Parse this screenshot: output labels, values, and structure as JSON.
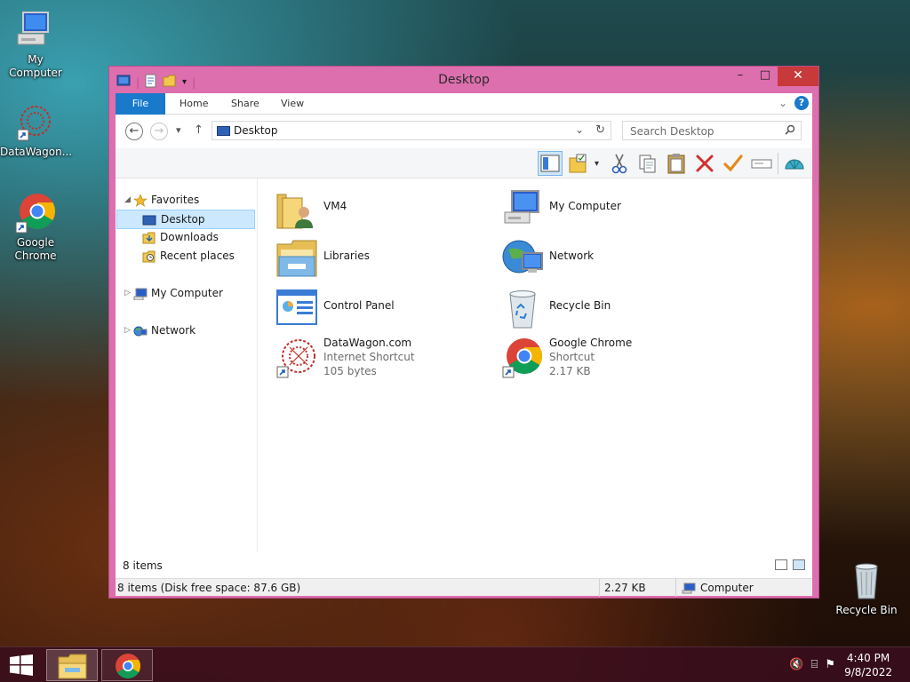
{
  "desktop": {
    "icons": [
      {
        "label": "My Computer",
        "icon": "computer-icon"
      },
      {
        "label": "DataWagon...",
        "icon": "datawagon-icon"
      },
      {
        "label": "Google Chrome",
        "icon": "chrome-icon"
      },
      {
        "label": "Recycle Bin",
        "icon": "recycle-bin-icon"
      }
    ]
  },
  "window": {
    "title": "Desktop",
    "controls": {
      "minimize": "–",
      "maximize": "□",
      "close": "✕"
    },
    "ribbon": {
      "tabs": [
        "File",
        "Home",
        "Share",
        "View"
      ],
      "expand": "⌄",
      "help": "?"
    },
    "address": {
      "back": "←",
      "forward": "→",
      "recent": "▾",
      "up": "↑",
      "path": "Desktop",
      "dropdown": "⌄",
      "refresh": "↻"
    },
    "search": {
      "placeholder": "Search Desktop",
      "icon": "🔍"
    },
    "navpane": {
      "favorites": "Favorites",
      "desktop": "Desktop",
      "downloads": "Downloads",
      "recent": "Recent places",
      "computer": "My Computer",
      "network": "Network",
      "expanded": "◢",
      "collapsed": "▷"
    },
    "items": [
      {
        "name": "VM4",
        "icon": "user-folder-icon"
      },
      {
        "name": "My Computer",
        "icon": "computer-icon"
      },
      {
        "name": "Libraries",
        "icon": "libraries-icon"
      },
      {
        "name": "Network",
        "icon": "network-icon"
      },
      {
        "name": "Control Panel",
        "icon": "control-panel-icon"
      },
      {
        "name": "Recycle Bin",
        "icon": "recycle-bin-icon"
      },
      {
        "name": "DataWagon.com",
        "type": "Internet Shortcut",
        "size": "105 bytes",
        "icon": "datawagon-icon"
      },
      {
        "name": "Google Chrome",
        "type": "Shortcut",
        "size": "2.17 KB",
        "icon": "chrome-icon"
      }
    ],
    "count": "8 items",
    "status": {
      "left": "8 items (Disk free space: 87.6 GB)",
      "size": "2.27 KB",
      "location": "Computer"
    }
  },
  "taskbar": {
    "time": "4:40 PM",
    "date": "9/8/2022",
    "tray": [
      "🔇",
      "⌸",
      "⚑"
    ]
  },
  "colors": {
    "window_frame": "#dd6fae",
    "file_tab": "#1979ca",
    "close": "#c7393a"
  }
}
